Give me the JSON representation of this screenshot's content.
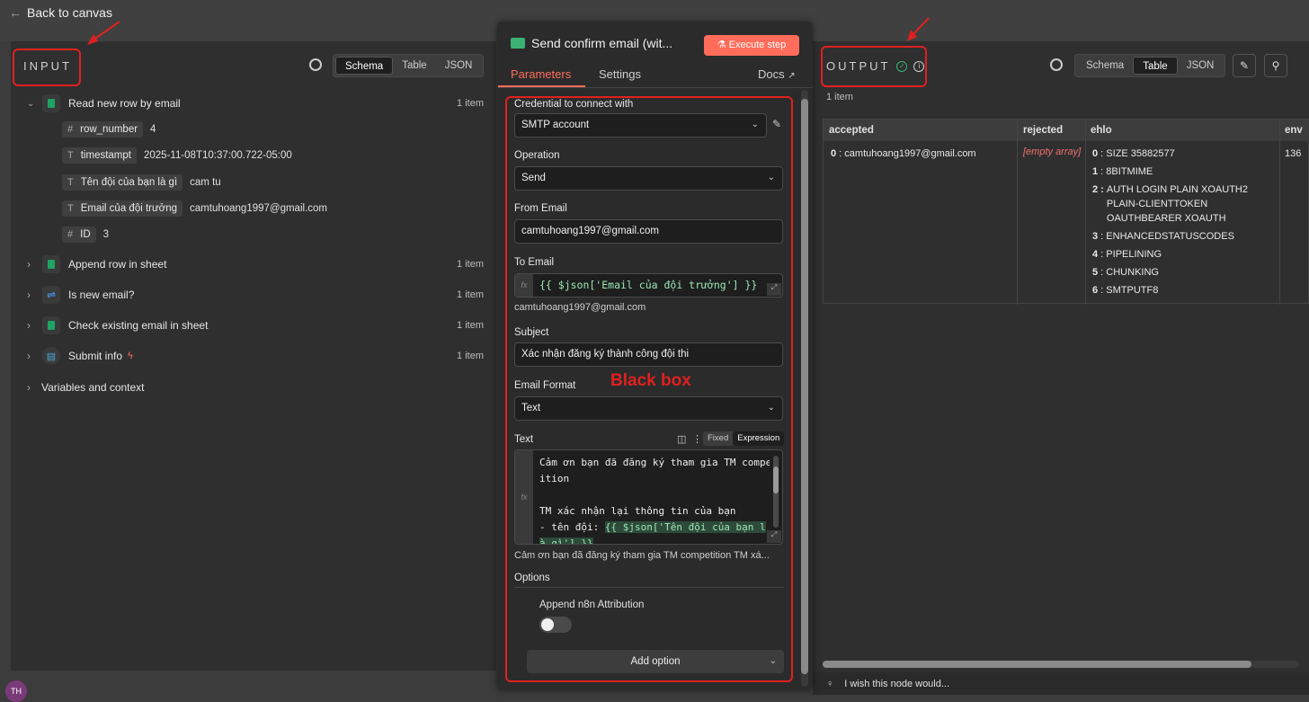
{
  "topbar": {
    "back_label": "Back to canvas"
  },
  "input": {
    "title": "INPUT",
    "tabs": [
      "Schema",
      "Table",
      "JSON"
    ],
    "nodes": [
      {
        "name": "Read new row by email",
        "count": "1 item"
      },
      {
        "name": "Append row in sheet",
        "count": "1 item"
      },
      {
        "name": "Is new email?",
        "count": "1 item"
      },
      {
        "name": "Check existing email in sheet",
        "count": "1 item"
      },
      {
        "name": "Submit info",
        "count": "1 item"
      }
    ],
    "fields": [
      {
        "type": "#",
        "key": "row_number",
        "value": "4"
      },
      {
        "type": "T",
        "key": "timestampt",
        "value": "2025-11-08T10:37:00.722-05:00"
      },
      {
        "type": "T",
        "key": "Tên đội của bạn là gì",
        "value": "cam tu"
      },
      {
        "type": "T",
        "key": "Email của đội trưởng",
        "value": "camtuhoang1997@gmail.com"
      },
      {
        "type": "#",
        "key": "ID",
        "value": "3"
      }
    ],
    "variables": "Variables and context"
  },
  "node": {
    "title": "Send confirm email (wit...",
    "execute": "Execute step",
    "tabs": {
      "parameters": "Parameters",
      "settings": "Settings",
      "docs": "Docs"
    },
    "credential_label": "Credential to connect with",
    "credential_value": "SMTP account",
    "operation_label": "Operation",
    "operation_value": "Send",
    "from_label": "From Email",
    "from_value": "camtuhoang1997@gmail.com",
    "to_label": "To Email",
    "to_expr": "{{ $json['Email của đội trưởng'] }}",
    "to_result": "camtuhoang1997@gmail.com",
    "subject_label": "Subject",
    "subject_value": "Xác nhận đăng ký thành công đội thi",
    "format_label": "Email Format",
    "format_value": "Text",
    "text_label": "Text",
    "fixed": "Fixed",
    "expression": "Expression",
    "text_lines": [
      "Cảm ơn bạn đã đăng ký tham gia TM compet",
      "ition",
      "",
      "TM xác nhận lại thông tin của bạn",
      "- tên đội: "
    ],
    "text_expr1": "{{ $json['Tên đội của bạn l",
    "text_expr2": "à gì'] }}",
    "text_preview": "Cảm ơn bạn đã đăng ký tham gia TM competition TM xá...",
    "options_label": "Options",
    "attribution_label": "Append n8n Attribution",
    "add_option": "Add option",
    "annotation": "Black box"
  },
  "output": {
    "title": "OUTPUT",
    "tabs": [
      "Schema",
      "Table",
      "JSON"
    ],
    "items": "1 item",
    "columns": [
      "accepted",
      "rejected",
      "ehlo",
      "env"
    ],
    "accepted": "camtuhoang1997@gmail.com",
    "rejected": "[empty array]",
    "ehlo": [
      "SIZE 35882577",
      "8BITMIME",
      "AUTH LOGIN PLAIN XOAUTH2 PLAIN-CLIENTTOKEN OAUTHBEARER XOAUTH",
      "ENHANCEDSTATUSCODES",
      "PIPELINING",
      "CHUNKING",
      "SMTPUTF8"
    ],
    "env_value": "136",
    "feedback": "I wish this node would..."
  },
  "colors": {
    "accent": "#ff6d5a",
    "red_annotation": "#e02020",
    "green": "#3bb273"
  }
}
